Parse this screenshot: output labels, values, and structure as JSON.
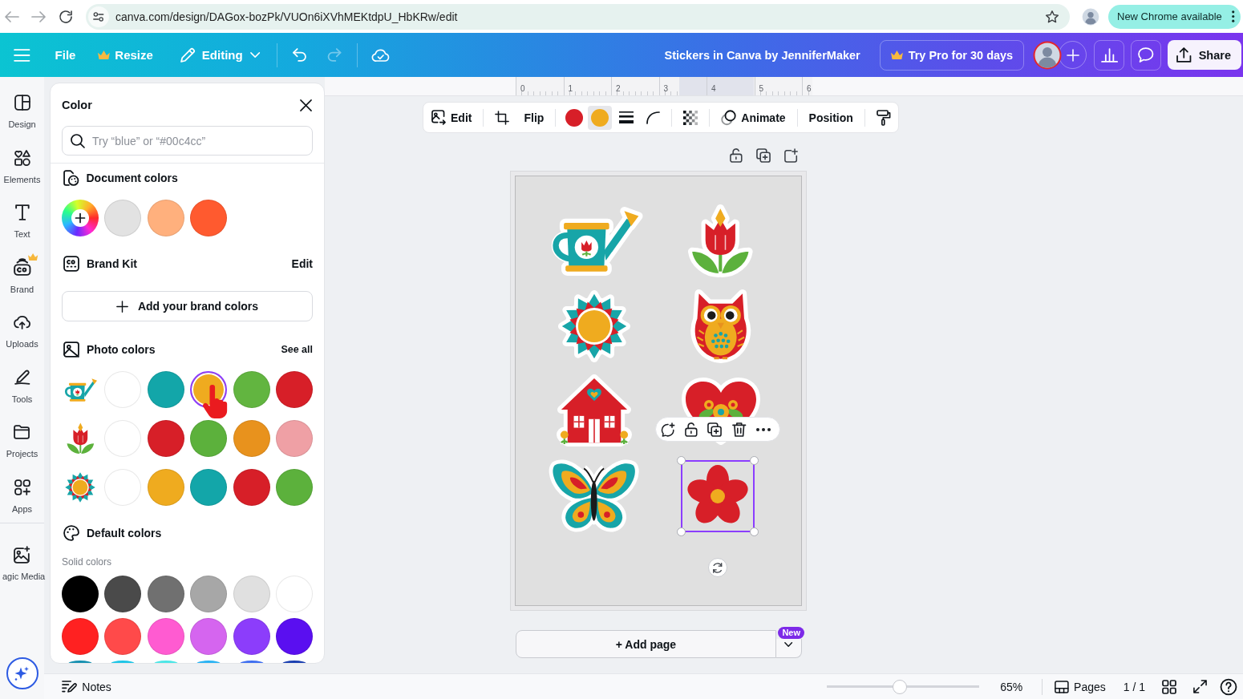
{
  "browser": {
    "url": "canva.com/design/DAGox-bozPk/VUOn6iXVhMEKtdpU_HbKRw/edit",
    "update_button": "New Chrome available"
  },
  "top_bar": {
    "file": "File",
    "resize": "Resize",
    "mode": "Editing",
    "undo": {
      "disabled": false
    },
    "redo": {
      "disabled": true
    },
    "design_title": "Stickers in Canva by JenniferMaker",
    "pro_button": "Try Pro for 30 days",
    "share_button": "Share"
  },
  "side_rail": {
    "items": [
      {
        "kind": "design",
        "label": "Design",
        "pro": false,
        "selected": false
      },
      {
        "kind": "elements",
        "label": "Elements",
        "pro": false,
        "selected": false
      },
      {
        "kind": "text",
        "label": "Text",
        "pro": false,
        "selected": false
      },
      {
        "kind": "brand",
        "label": "Brand",
        "pro": true,
        "selected": false
      },
      {
        "kind": "uploads",
        "label": "Uploads",
        "pro": false,
        "selected": false
      },
      {
        "kind": "tools",
        "label": "Tools",
        "pro": false,
        "selected": false
      },
      {
        "kind": "projects",
        "label": "Projects",
        "pro": false,
        "selected": false
      },
      {
        "kind": "apps",
        "label": "Apps",
        "pro": false,
        "selected": false
      }
    ],
    "more_items": [
      {
        "kind": "magic_media",
        "label": "agic Media",
        "pro": false,
        "selected": false
      }
    ]
  },
  "color_panel": {
    "title": "Color",
    "search": {
      "placeholder": "Try “blue” or “#00c4cc”"
    },
    "document_colors": {
      "title": "Document colors",
      "swatches": [
        {
          "color": "#e2e2e2",
          "selected": false
        },
        {
          "color": "#ffb07d",
          "selected": false
        },
        {
          "color": "#ff5a2f",
          "selected": false
        }
      ]
    },
    "brand_kit": {
      "title": "Brand Kit",
      "action": "Edit",
      "add_button": "Add your brand colors"
    },
    "photo_colors": {
      "title": "Photo colors",
      "action": "See all",
      "rows": [
        {
          "kind": "watering_can",
          "swatches": [
            {
              "color": "#ffffff",
              "selected": false
            },
            {
              "color": "#13a6a9",
              "selected": false
            },
            {
              "color": "#efab1f",
              "selected": true
            },
            {
              "color": "#62b540",
              "selected": false
            },
            {
              "color": "#d71f28",
              "selected": false
            }
          ]
        },
        {
          "kind": "tulip",
          "swatches": [
            {
              "color": "#ffffff",
              "selected": false
            },
            {
              "color": "#d71f28",
              "selected": false
            },
            {
              "color": "#5cb13c",
              "selected": false
            },
            {
              "color": "#e8921d",
              "selected": false
            },
            {
              "color": "#efa0a5",
              "selected": false
            }
          ]
        },
        {
          "kind": "mandala",
          "swatches": [
            {
              "color": "#ffffff",
              "selected": false
            },
            {
              "color": "#efab1f",
              "selected": false
            },
            {
              "color": "#13a6a9",
              "selected": false
            },
            {
              "color": "#d71f28",
              "selected": false
            },
            {
              "color": "#5cb13c",
              "selected": false
            }
          ]
        }
      ]
    },
    "default_colors": {
      "title": "Default colors",
      "subtitle": "Solid colors",
      "swatches": [
        {
          "color": "#000000",
          "selected": false
        },
        {
          "color": "#4a4a4a",
          "selected": false
        },
        {
          "color": "#707070",
          "selected": false
        },
        {
          "color": "#a7a7a7",
          "selected": false
        },
        {
          "color": "#e0e0e0",
          "selected": false
        },
        {
          "color": "#ffffff",
          "selected": false
        },
        {
          "color": "#ff2121",
          "selected": false
        },
        {
          "color": "#ff4a4a",
          "selected": false
        },
        {
          "color": "#ff5bd1",
          "selected": false
        },
        {
          "color": "#d565ef",
          "selected": false
        },
        {
          "color": "#8c3dfb",
          "selected": false
        },
        {
          "color": "#5a0ff0",
          "selected": false
        },
        {
          "color": "#1690b0",
          "selected": false
        },
        {
          "color": "#1ec5e6",
          "selected": false
        },
        {
          "color": "#4ce6e6",
          "selected": false
        },
        {
          "color": "#2ab3f3",
          "selected": false
        },
        {
          "color": "#3f6ff0",
          "selected": false
        },
        {
          "color": "#1a3fb0",
          "selected": false
        }
      ]
    }
  },
  "ruler": {
    "ticks": [
      "0",
      "1",
      "2",
      "3",
      "4",
      "5",
      "6"
    ]
  },
  "context_toolbar": {
    "edit": "Edit",
    "flip": "Flip",
    "colors": [
      {
        "color": "#d71f28",
        "selected": false
      },
      {
        "color": "#efab1f",
        "selected": true
      }
    ],
    "animate": "Animate",
    "position": "Position"
  },
  "page": {
    "stickers": [
      {
        "kind": "watering_can",
        "selected": false
      },
      {
        "kind": "tulip",
        "selected": false
      },
      {
        "kind": "mandala",
        "selected": false
      },
      {
        "kind": "owl",
        "selected": false
      },
      {
        "kind": "house",
        "selected": false
      },
      {
        "kind": "heart",
        "selected": false
      },
      {
        "kind": "butterfly",
        "selected": false
      },
      {
        "kind": "flower",
        "selected": true
      }
    ]
  },
  "add_page": {
    "label": "+ Add page",
    "badge": "New"
  },
  "bottom_bar": {
    "notes": "Notes",
    "zoom": {
      "level": 0.48,
      "reading": "65%"
    },
    "pages": "Pages",
    "page_count": "1 / 1"
  }
}
